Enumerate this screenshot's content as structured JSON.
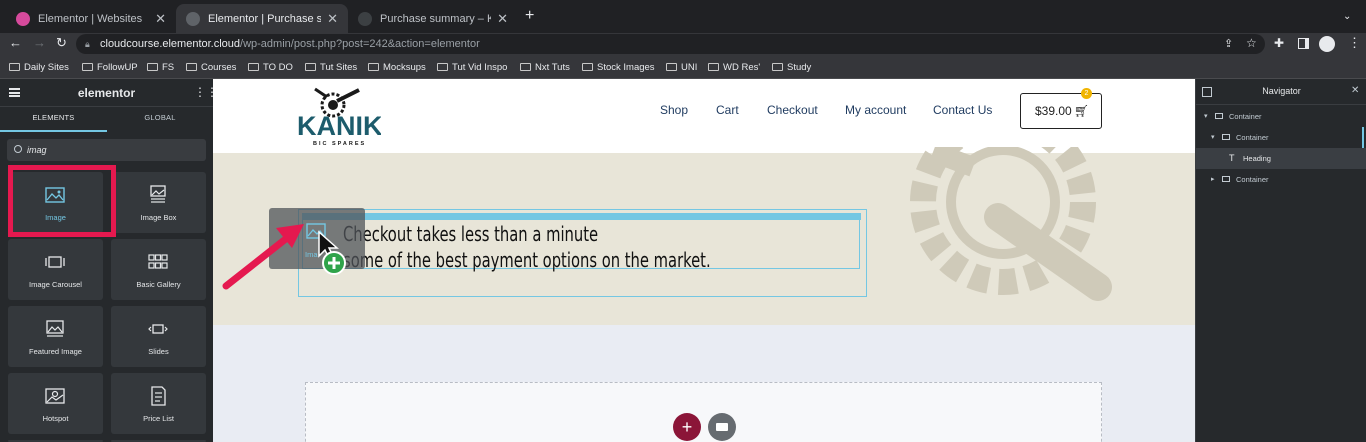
{
  "browser": {
    "tabs": [
      {
        "title": "Elementor | Websites",
        "active": false
      },
      {
        "title": "Elementor | Purchase summary",
        "active": true
      },
      {
        "title": "Purchase summary – Kanika Pa",
        "active": false
      }
    ],
    "new_tab": "+",
    "url_host": "cloudcourse.elementor.cloud",
    "url_rest": "/wp-admin/post.php?post=242&action=elementor",
    "bookmarks": [
      "Daily Sites",
      "FollowUP",
      "FS",
      "Courses",
      "TO DO",
      "Tut Sites",
      "Mocksups",
      "Tut Vid Inspo",
      "Nxt Tuts",
      "Stock Images",
      "UNI",
      "WD Res'",
      "Study"
    ]
  },
  "elementor": {
    "brand": "elementor",
    "tabs": [
      "ELEMENTS",
      "GLOBAL"
    ],
    "search_value": "imag",
    "widgets": [
      "Image",
      "Image Box",
      "Image Carousel",
      "Basic Gallery",
      "Featured Image",
      "Slides",
      "Hotspot",
      "Price List"
    ],
    "drag_label": "Ima"
  },
  "site": {
    "logo_text": "KANIKA",
    "logo_sub": "BIC SPARES",
    "nav": [
      "Shop",
      "Cart",
      "Checkout",
      "My account",
      "Contact Us"
    ],
    "cart_price": "$39.00",
    "cart_count": "2",
    "heading_line1": "Checkout takes less than a minute",
    "heading_line2": "some of the best payment options on the market."
  },
  "navigator": {
    "title": "Navigator",
    "items": [
      "Container",
      "Container",
      "Heading",
      "Container"
    ]
  },
  "colors": {
    "highlight": "#e5194f",
    "accent": "#74c7e3",
    "add_button": "#8b1538"
  }
}
